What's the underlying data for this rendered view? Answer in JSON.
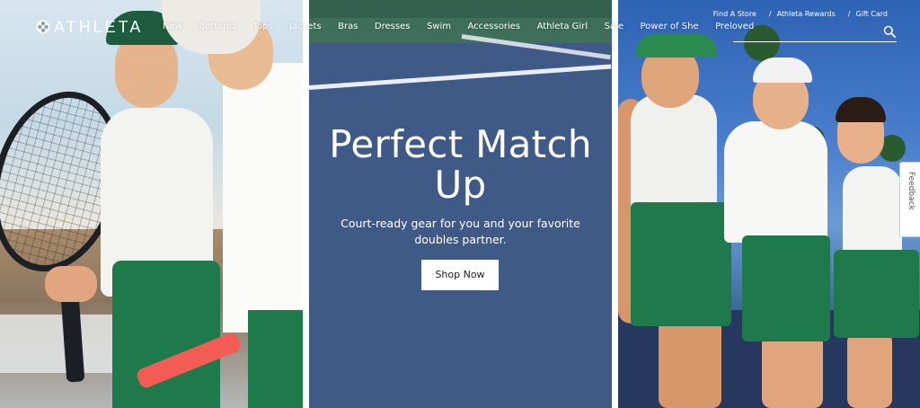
{
  "brand": {
    "name": "ATHLETA",
    "logo_icon": "athleta-flower-icon"
  },
  "nav": {
    "items": [
      {
        "label": "New"
      },
      {
        "label": "Bottoms"
      },
      {
        "label": "Tops"
      },
      {
        "label": "Jackets"
      },
      {
        "label": "Bras"
      },
      {
        "label": "Dresses"
      },
      {
        "label": "Swim"
      },
      {
        "label": "Accessories"
      },
      {
        "label": "Athleta Girl"
      },
      {
        "label": "Sale"
      },
      {
        "label": "Power of She"
      },
      {
        "label": "Preloved"
      }
    ]
  },
  "utility": {
    "find_store": "Find A Store",
    "rewards": "Athleta Rewards",
    "gift_card": "Gift Card",
    "separator": "/"
  },
  "search": {
    "placeholder": "",
    "icon": "search-icon"
  },
  "hero": {
    "title": "Perfect Match Up",
    "subtitle": "Court-ready gear for you and your favorite doubles partner.",
    "cta_label": "Shop Now"
  },
  "feedback": {
    "label": "Feedback"
  },
  "colors": {
    "court_blue": "#3f5a86",
    "skirt_green": "#1f7a4b",
    "text_white": "#ffffff"
  }
}
